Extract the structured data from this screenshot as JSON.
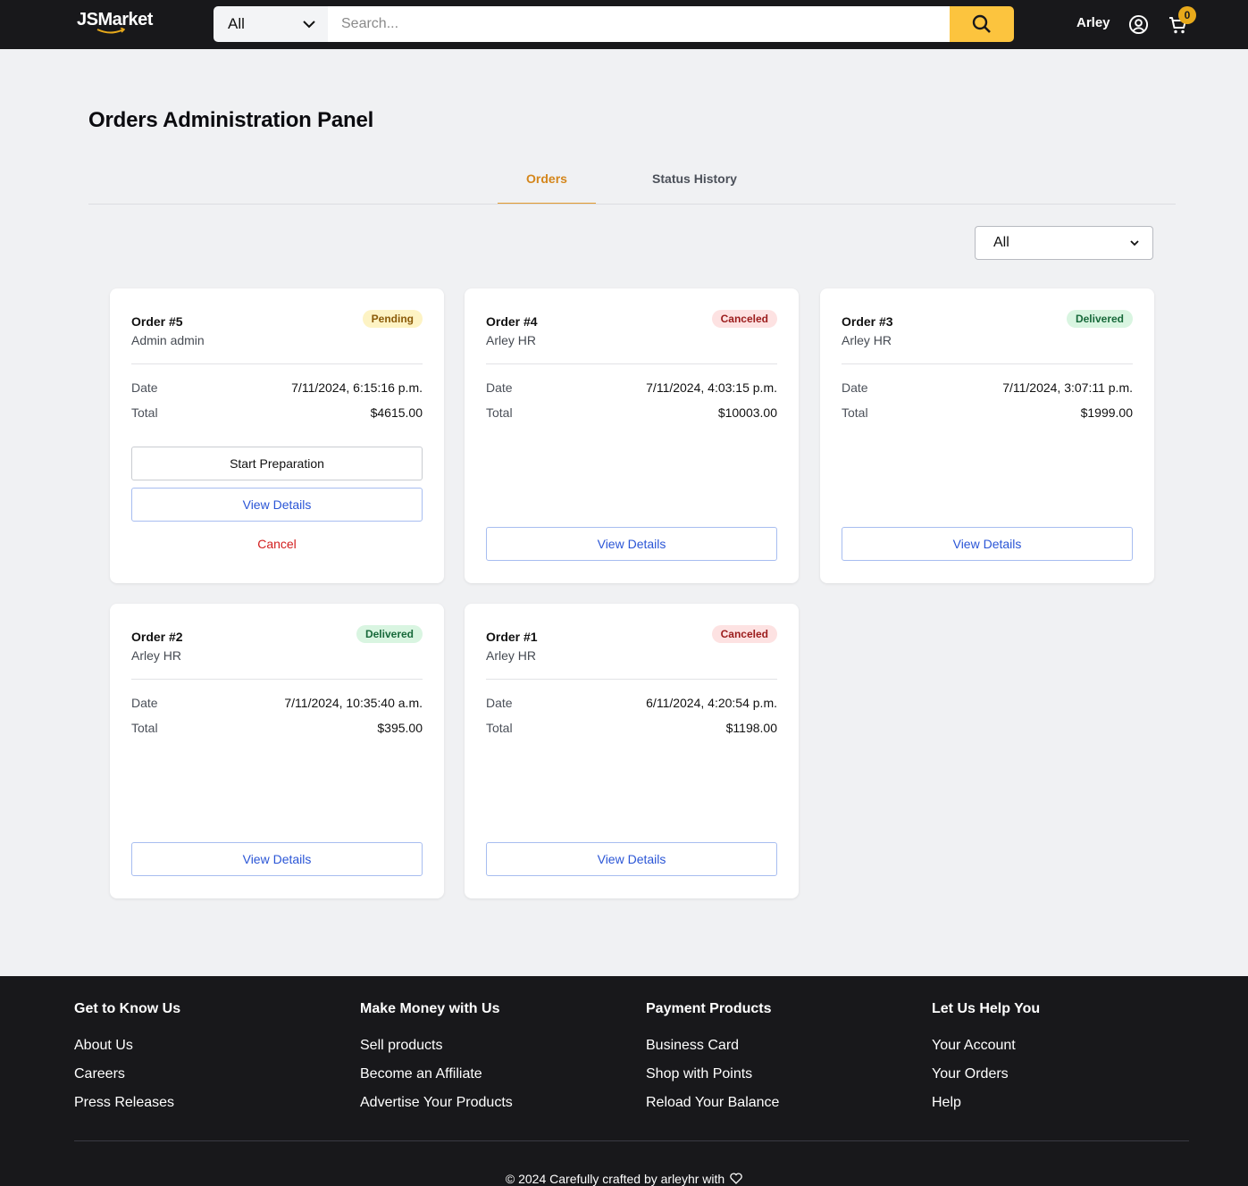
{
  "header": {
    "logo": "JSMarket",
    "search_category": "All",
    "search_placeholder": "Search...",
    "user_name": "Arley",
    "cart_count": "0",
    "accent_color": "#fcc43e"
  },
  "page": {
    "title": "Orders Administration Panel",
    "tabs": [
      "Orders",
      "Status History"
    ],
    "active_tab": "Orders",
    "filter_value": "All"
  },
  "orders": [
    {
      "id": "Order #5",
      "customer": "Admin admin",
      "status": "Pending",
      "date_label": "Date",
      "date": "7/11/2024, 6:15:16 p.m.",
      "total_label": "Total",
      "total": "$4615.00",
      "start_label": "Start Preparation",
      "view_label": "View Details",
      "cancel_label": "Cancel"
    },
    {
      "id": "Order #4",
      "customer": "Arley HR",
      "status": "Canceled",
      "date_label": "Date",
      "date": "7/11/2024, 4:03:15 p.m.",
      "total_label": "Total",
      "total": "$10003.00",
      "view_label": "View Details"
    },
    {
      "id": "Order #3",
      "customer": "Arley HR",
      "status": "Delivered",
      "date_label": "Date",
      "date": "7/11/2024, 3:07:11 p.m.",
      "total_label": "Total",
      "total": "$1999.00",
      "view_label": "View Details"
    },
    {
      "id": "Order #2",
      "customer": "Arley HR",
      "status": "Delivered",
      "date_label": "Date",
      "date": "7/11/2024, 10:35:40 a.m.",
      "total_label": "Total",
      "total": "$395.00",
      "view_label": "View Details"
    },
    {
      "id": "Order #1",
      "customer": "Arley HR",
      "status": "Canceled",
      "date_label": "Date",
      "date": "6/11/2024, 4:20:54 p.m.",
      "total_label": "Total",
      "total": "$1198.00",
      "view_label": "View Details"
    }
  ],
  "footer": {
    "columns": [
      {
        "title": "Get to Know Us",
        "links": [
          "About Us",
          "Careers",
          "Press Releases"
        ]
      },
      {
        "title": "Make Money with Us",
        "links": [
          "Sell products",
          "Become an Affiliate",
          "Advertise Your Products"
        ]
      },
      {
        "title": "Payment Products",
        "links": [
          "Business Card",
          "Shop with Points",
          "Reload Your Balance"
        ]
      },
      {
        "title": "Let Us Help You",
        "links": [
          "Your Account",
          "Your Orders",
          "Help"
        ]
      }
    ],
    "copyright": "© 2024 Carefully crafted by arleyhr with",
    "copyright_icon": "heart-icon"
  }
}
